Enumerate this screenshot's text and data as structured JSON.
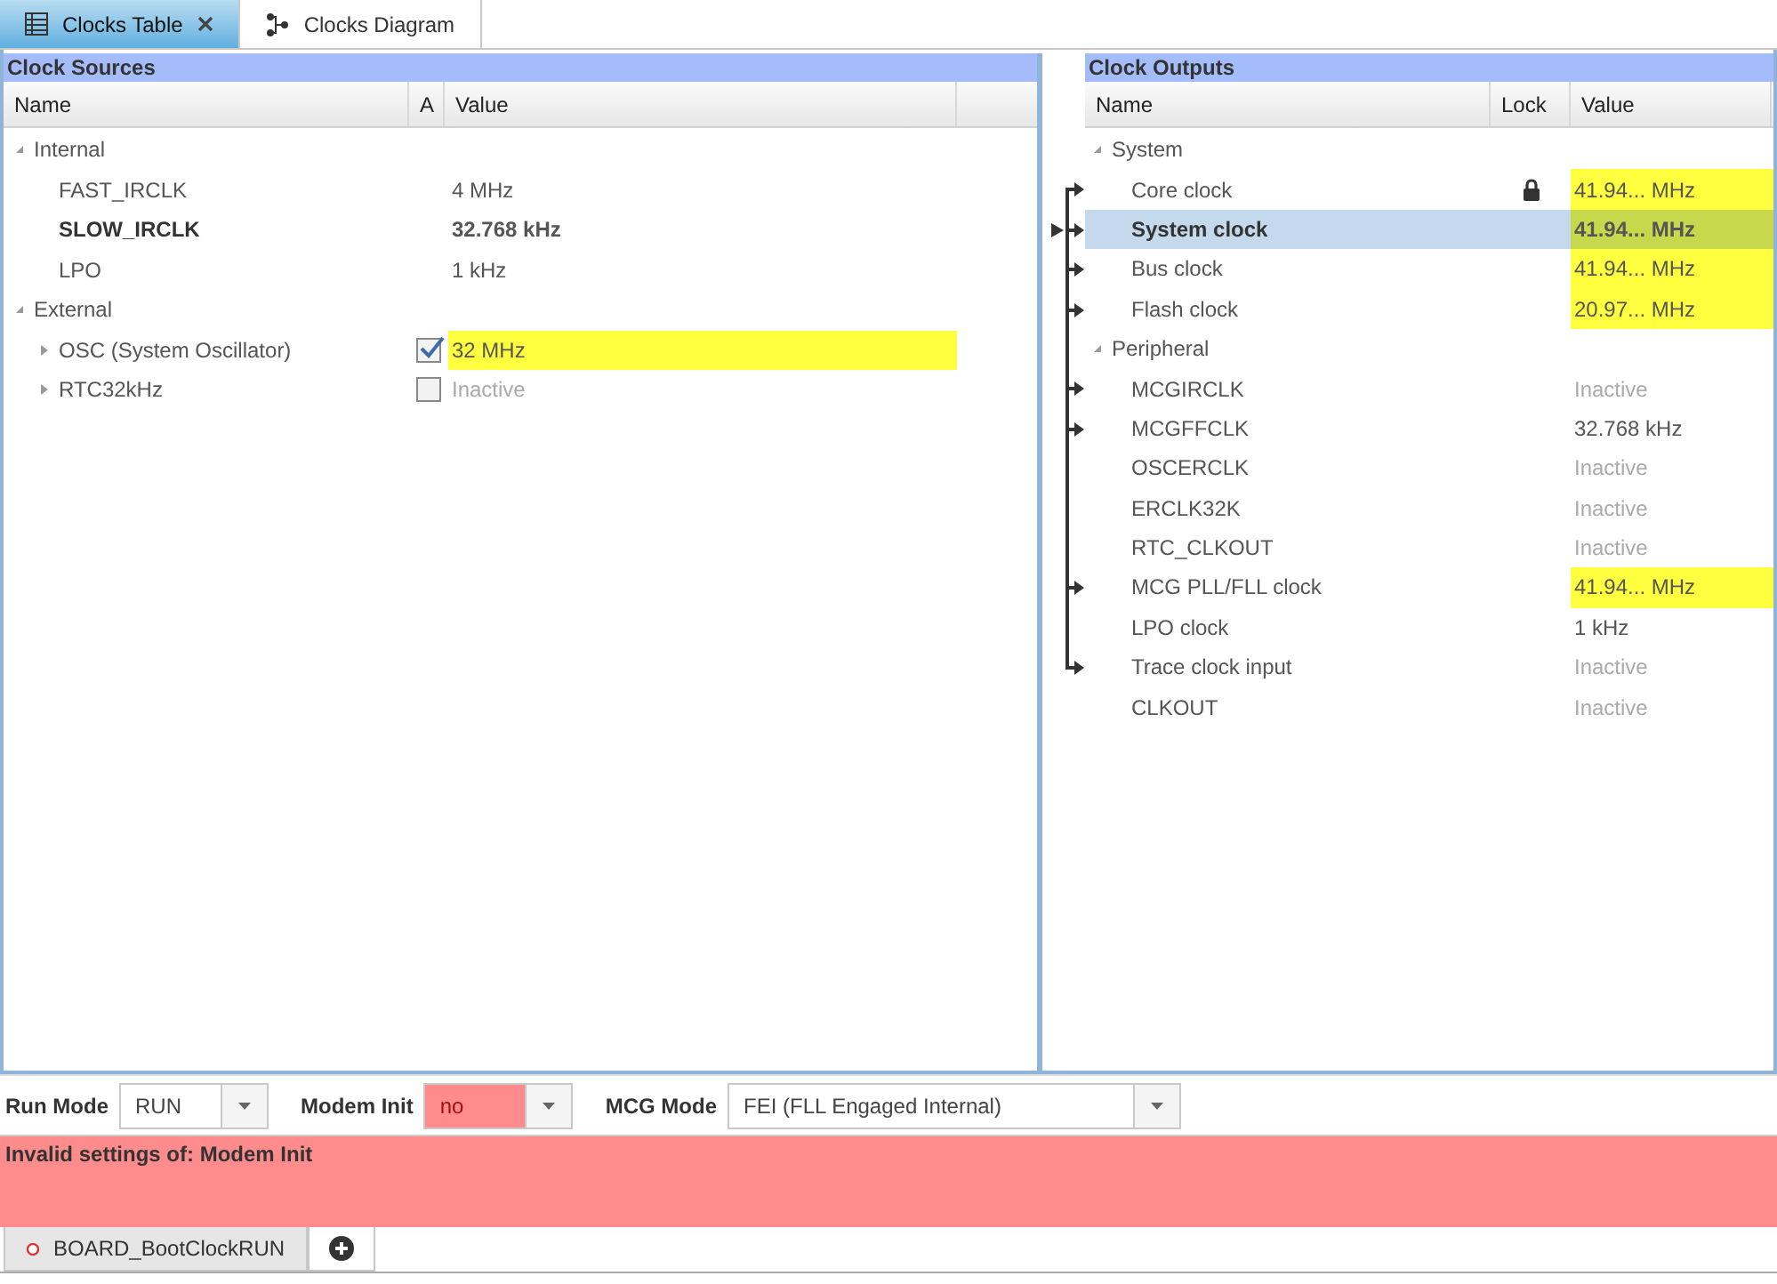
{
  "tabs": [
    {
      "label": "Clocks Table",
      "selected": true,
      "closable": true,
      "kind": "table"
    },
    {
      "label": "Clocks Diagram",
      "selected": false,
      "closable": false,
      "kind": "diagram"
    }
  ],
  "clock_sources": {
    "title": "Clock Sources",
    "columns": [
      "Name",
      "A",
      "Value"
    ],
    "groups": [
      {
        "name": "Internal",
        "expanded": true,
        "children": [
          {
            "name": "FAST_IRCLK",
            "value": "4 MHz",
            "bold": false,
            "highlight": false,
            "inactive": false
          },
          {
            "name": "SLOW_IRCLK",
            "value": "32.768 kHz",
            "bold": true,
            "highlight": false,
            "inactive": false
          },
          {
            "name": "LPO",
            "value": "1 kHz",
            "bold": false,
            "highlight": false,
            "inactive": false
          }
        ]
      },
      {
        "name": "External",
        "expanded": true,
        "children": [
          {
            "name": "OSC (System Oscillator)",
            "value": "32 MHz",
            "bold": false,
            "highlight": true,
            "inactive": false,
            "expanded": false,
            "checked": true
          },
          {
            "name": "RTC32kHz",
            "value": "Inactive",
            "bold": false,
            "highlight": false,
            "inactive": true,
            "expanded": false,
            "checked": false
          }
        ]
      }
    ]
  },
  "clock_outputs": {
    "title": "Clock Outputs",
    "columns": [
      "Name",
      "Lock",
      "Value"
    ],
    "groups": [
      {
        "name": "System",
        "expanded": true,
        "children": [
          {
            "name": "Core clock",
            "value": "41.94... MHz",
            "locked": true,
            "arrow": true,
            "selected": false,
            "highlight": true,
            "inactive": false
          },
          {
            "name": "System clock",
            "value": "41.94... MHz",
            "locked": false,
            "arrow": true,
            "selected": true,
            "highlight": true,
            "inactive": false
          },
          {
            "name": "Bus clock",
            "value": "41.94... MHz",
            "locked": false,
            "arrow": true,
            "selected": false,
            "highlight": true,
            "inactive": false
          },
          {
            "name": "Flash clock",
            "value": "20.97... MHz",
            "locked": false,
            "arrow": true,
            "selected": false,
            "highlight": true,
            "inactive": false
          }
        ]
      },
      {
        "name": "Peripheral",
        "expanded": true,
        "children": [
          {
            "name": "MCGIRCLK",
            "value": "Inactive",
            "locked": false,
            "arrow": true,
            "selected": false,
            "highlight": false,
            "inactive": true
          },
          {
            "name": "MCGFFCLK",
            "value": "32.768 kHz",
            "locked": false,
            "arrow": true,
            "selected": false,
            "highlight": false,
            "inactive": false
          },
          {
            "name": "OSCERCLK",
            "value": "Inactive",
            "locked": false,
            "arrow": false,
            "selected": false,
            "highlight": false,
            "inactive": true
          },
          {
            "name": "ERCLK32K",
            "value": "Inactive",
            "locked": false,
            "arrow": false,
            "selected": false,
            "highlight": false,
            "inactive": true
          },
          {
            "name": "RTC_CLKOUT",
            "value": "Inactive",
            "locked": false,
            "arrow": false,
            "selected": false,
            "highlight": false,
            "inactive": true
          },
          {
            "name": "MCG PLL/FLL clock",
            "value": "41.94... MHz",
            "locked": false,
            "arrow": true,
            "selected": false,
            "highlight": true,
            "inactive": false
          },
          {
            "name": "LPO clock",
            "value": "1 kHz",
            "locked": false,
            "arrow": false,
            "selected": false,
            "highlight": false,
            "inactive": false
          },
          {
            "name": "Trace clock input",
            "value": "Inactive",
            "locked": false,
            "arrow": true,
            "selected": false,
            "highlight": false,
            "inactive": true
          },
          {
            "name": "CLKOUT",
            "value": "Inactive",
            "locked": false,
            "arrow": false,
            "selected": false,
            "highlight": false,
            "inactive": true
          }
        ]
      }
    ]
  },
  "settings": [
    {
      "label": "Run Mode",
      "value": "RUN",
      "invalid": false
    },
    {
      "label": "Modem Init",
      "value": "no",
      "invalid": true
    },
    {
      "label": "MCG Mode",
      "value": "FEI (FLL Engaged Internal)",
      "invalid": false
    }
  ],
  "message": "Invalid settings of: Modem Init",
  "configs": [
    {
      "label": "BOARD_BootClockRUN",
      "error": true
    }
  ]
}
